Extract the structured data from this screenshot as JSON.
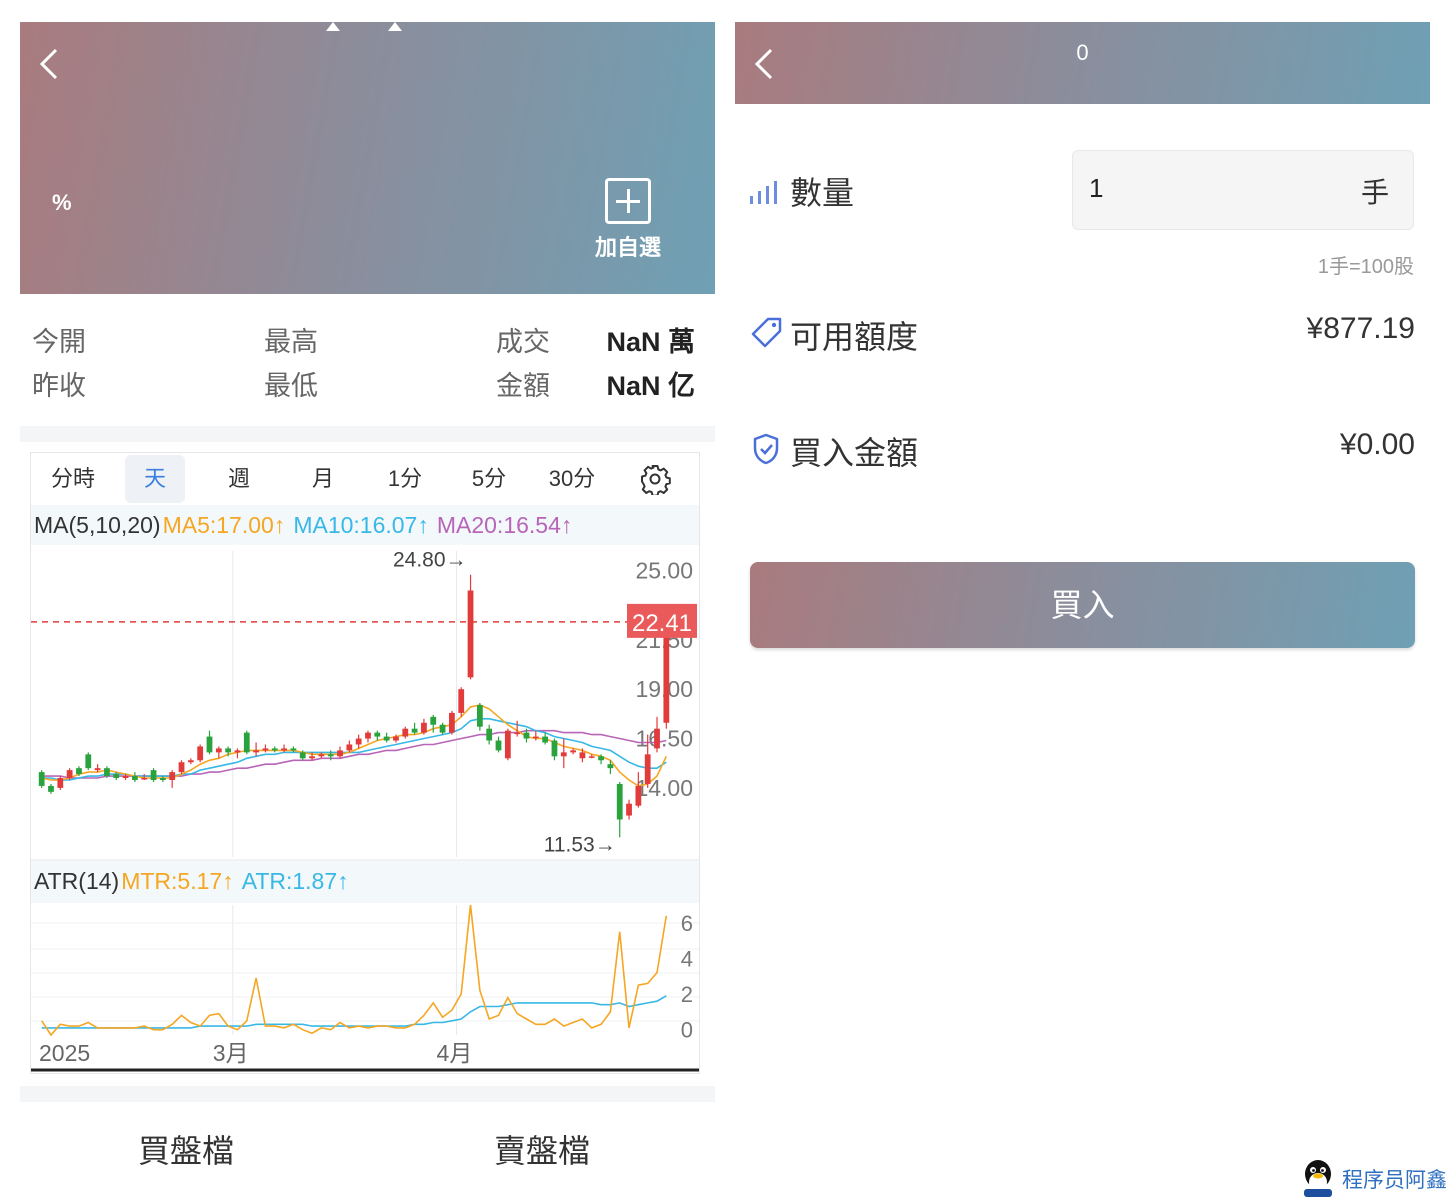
{
  "left_header": {
    "percent_label": "%",
    "add_favorite_label": "加自選"
  },
  "quote": {
    "open_label": "今開",
    "prev_close_label": "昨收",
    "high_label": "最高",
    "low_label": "最低",
    "volume_label": "成交",
    "amount_label": "金額",
    "volume_value": "NaN 萬",
    "amount_value": "NaN 亿"
  },
  "periods": [
    "分時",
    "天",
    "週",
    "月",
    "1分",
    "5分",
    "30分"
  ],
  "active_period": "天",
  "ma_indicator": {
    "name": "MA(5,10,20)",
    "ma5": "MA5:17.00↑",
    "ma10": "MA10:16.07↑",
    "ma20": "MA20:16.54↑"
  },
  "atr_indicator": {
    "name": "ATR(14)",
    "mtr": "MTR:5.17↑",
    "atr": "ATR:1.87↑"
  },
  "colors": {
    "up": "#e23b3b",
    "down": "#2aa33f",
    "ma5": "#f5a623",
    "ma10": "#38b8e6",
    "ma20": "#b865b8",
    "accent": "#3a7ee0"
  },
  "chart_data": [
    {
      "type": "candlestick",
      "title": "",
      "x_labels": [
        "2025",
        "3月",
        "4月"
      ],
      "y_ticks": [
        "25.00",
        "21.50",
        "19.00",
        "16.50",
        "14.00"
      ],
      "ylim": [
        10.5,
        26.0
      ],
      "last_price": "22.41",
      "max_label": "24.80→",
      "min_label": "11.53→",
      "candles": [
        [
          14.8,
          14.1,
          14.9,
          14.0
        ],
        [
          14.1,
          13.8,
          14.2,
          13.7
        ],
        [
          14.0,
          14.5,
          14.6,
          13.9
        ],
        [
          14.5,
          14.9,
          15.0,
          14.4
        ],
        [
          15.0,
          14.7,
          15.1,
          14.6
        ],
        [
          15.7,
          15.0,
          15.8,
          14.9
        ],
        [
          14.9,
          15.0,
          15.2,
          14.8
        ],
        [
          15.0,
          14.6,
          15.1,
          14.5
        ],
        [
          14.7,
          14.5,
          14.8,
          14.4
        ],
        [
          14.5,
          14.6,
          14.7,
          14.4
        ],
        [
          14.6,
          14.4,
          14.8,
          14.3
        ],
        [
          14.5,
          14.5,
          14.7,
          14.4
        ],
        [
          14.9,
          14.4,
          15.0,
          14.3
        ],
        [
          14.5,
          14.4,
          14.6,
          14.3
        ],
        [
          14.4,
          14.8,
          14.9,
          14.0
        ],
        [
          14.8,
          15.3,
          15.4,
          14.7
        ],
        [
          15.3,
          15.4,
          15.5,
          15.2
        ],
        [
          15.4,
          16.1,
          16.2,
          15.3
        ],
        [
          16.6,
          15.8,
          16.9,
          15.7
        ],
        [
          15.8,
          16.0,
          16.1,
          15.5
        ],
        [
          16.0,
          15.8,
          16.1,
          15.6
        ],
        [
          15.8,
          15.9,
          16.0,
          15.5
        ],
        [
          16.8,
          15.8,
          16.9,
          15.7
        ],
        [
          15.8,
          15.9,
          16.3,
          15.6
        ],
        [
          15.9,
          16.0,
          16.2,
          15.8
        ],
        [
          16.0,
          15.9,
          16.1,
          15.8
        ],
        [
          15.9,
          16.0,
          16.2,
          15.8
        ],
        [
          16.0,
          15.9,
          16.1,
          15.8
        ],
        [
          15.8,
          15.5,
          15.9,
          15.4
        ],
        [
          15.5,
          15.6,
          15.8,
          15.4
        ],
        [
          15.6,
          15.7,
          15.8,
          15.5
        ],
        [
          15.7,
          15.6,
          15.9,
          15.4
        ],
        [
          15.6,
          15.9,
          16.1,
          15.5
        ],
        [
          15.9,
          16.2,
          16.4,
          15.8
        ],
        [
          16.2,
          16.5,
          16.7,
          16.0
        ],
        [
          16.5,
          16.8,
          16.9,
          16.3
        ],
        [
          16.8,
          16.6,
          16.9,
          16.4
        ],
        [
          16.6,
          16.4,
          16.8,
          16.3
        ],
        [
          16.4,
          16.6,
          16.7,
          16.3
        ],
        [
          16.6,
          17.0,
          17.1,
          16.5
        ],
        [
          17.0,
          16.8,
          17.3,
          16.7
        ],
        [
          16.8,
          17.3,
          17.5,
          16.7
        ],
        [
          17.6,
          17.2,
          17.7,
          16.8
        ],
        [
          17.2,
          16.8,
          17.3,
          16.7
        ],
        [
          16.8,
          17.8,
          17.9,
          16.7
        ],
        [
          17.8,
          19.0,
          19.1,
          17.6
        ],
        [
          19.6,
          24.0,
          24.8,
          19.5
        ],
        [
          18.2,
          17.1,
          18.3,
          16.9
        ],
        [
          17.0,
          16.4,
          17.2,
          16.2
        ],
        [
          16.4,
          15.9,
          16.6,
          15.8
        ],
        [
          15.5,
          16.9,
          17.0,
          15.4
        ],
        [
          16.8,
          16.8,
          17.4,
          16.6
        ],
        [
          16.8,
          16.5,
          17.0,
          16.3
        ],
        [
          16.6,
          16.6,
          16.9,
          16.4
        ],
        [
          16.6,
          16.3,
          16.8,
          16.2
        ],
        [
          16.4,
          15.6,
          16.5,
          15.4
        ],
        [
          15.6,
          15.8,
          16.5,
          15.0
        ],
        [
          15.8,
          15.9,
          16.0,
          15.7
        ],
        [
          15.5,
          15.8,
          16.0,
          15.3
        ],
        [
          15.6,
          15.6,
          15.7,
          15.5
        ],
        [
          15.6,
          15.4,
          15.7,
          15.2
        ],
        [
          15.2,
          15.0,
          15.4,
          14.7
        ],
        [
          14.2,
          12.4,
          14.3,
          11.5
        ],
        [
          12.6,
          13.2,
          13.4,
          12.4
        ],
        [
          13.1,
          14.1,
          14.8,
          13.0
        ],
        [
          14.2,
          15.7,
          16.7,
          14.0
        ],
        [
          16.0,
          17.0,
          17.6,
          15.8
        ],
        [
          17.3,
          22.3,
          22.8,
          17.0
        ]
      ],
      "ma5": [
        14.5,
        14.4,
        14.4,
        14.5,
        14.7,
        14.8,
        14.8,
        14.9,
        14.8,
        14.7,
        14.6,
        14.5,
        14.5,
        14.5,
        14.5,
        14.7,
        14.9,
        15.2,
        15.4,
        15.5,
        15.7,
        15.8,
        15.9,
        15.9,
        15.9,
        15.9,
        15.9,
        15.9,
        15.8,
        15.7,
        15.7,
        15.7,
        15.7,
        15.8,
        16.0,
        16.2,
        16.4,
        16.5,
        16.6,
        16.7,
        16.7,
        16.8,
        17.0,
        17.1,
        17.2,
        17.6,
        18.1,
        18.2,
        18.0,
        17.6,
        17.2,
        16.9,
        16.6,
        16.5,
        16.5,
        16.3,
        16.1,
        16.0,
        15.9,
        15.7,
        15.6,
        15.4,
        14.8,
        14.4,
        14.1,
        14.2,
        14.6,
        15.6
      ],
      "ma10": [
        14.5,
        14.5,
        14.4,
        14.4,
        14.5,
        14.6,
        14.6,
        14.7,
        14.7,
        14.7,
        14.6,
        14.6,
        14.6,
        14.6,
        14.6,
        14.7,
        14.7,
        14.9,
        15.0,
        15.1,
        15.2,
        15.3,
        15.5,
        15.6,
        15.7,
        15.7,
        15.8,
        15.8,
        15.8,
        15.8,
        15.8,
        15.8,
        15.8,
        15.8,
        15.8,
        15.9,
        16.0,
        16.1,
        16.2,
        16.3,
        16.4,
        16.5,
        16.6,
        16.7,
        16.8,
        17.0,
        17.4,
        17.5,
        17.5,
        17.4,
        17.3,
        17.2,
        17.1,
        16.9,
        16.8,
        16.6,
        16.5,
        16.4,
        16.3,
        16.1,
        16.0,
        15.9,
        15.6,
        15.3,
        15.1,
        15.0,
        15.0,
        15.3
      ],
      "ma20": [
        14.6,
        14.6,
        14.6,
        14.5,
        14.5,
        14.5,
        14.5,
        14.6,
        14.6,
        14.6,
        14.6,
        14.6,
        14.6,
        14.6,
        14.6,
        14.6,
        14.7,
        14.7,
        14.8,
        14.8,
        14.9,
        15.0,
        15.0,
        15.1,
        15.2,
        15.2,
        15.3,
        15.4,
        15.4,
        15.4,
        15.5,
        15.5,
        15.5,
        15.6,
        15.7,
        15.7,
        15.8,
        15.9,
        15.9,
        16.0,
        16.1,
        16.2,
        16.2,
        16.3,
        16.4,
        16.5,
        16.6,
        16.7,
        16.7,
        16.8,
        16.8,
        16.8,
        16.9,
        16.9,
        16.9,
        16.9,
        16.8,
        16.8,
        16.8,
        16.7,
        16.7,
        16.6,
        16.5,
        16.4,
        16.3,
        16.3,
        16.3,
        16.4
      ]
    },
    {
      "type": "line",
      "title": "",
      "y_ticks": [
        "6",
        "4",
        "2",
        "0"
      ],
      "ylim": [
        -0.3,
        7.0
      ],
      "series": [
        {
          "name": "MTR",
          "values": [
            0.5,
            -0.3,
            0.3,
            0.2,
            0.2,
            0.4,
            0.1,
            0.1,
            0.1,
            0.1,
            0.1,
            0.2,
            0.0,
            0.0,
            0.3,
            0.8,
            0.4,
            0.2,
            0.8,
            0.9,
            0.2,
            0.0,
            0.5,
            2.9,
            0.2,
            0.2,
            0.1,
            0.3,
            0.0,
            -0.2,
            0.1,
            0.0,
            0.4,
            0.1,
            0.2,
            0.1,
            0.2,
            0.2,
            0.1,
            0.1,
            0.3,
            0.8,
            1.5,
            0.7,
            1.1,
            2.0,
            7.0,
            2.2,
            0.6,
            0.8,
            1.8,
            0.9,
            0.6,
            0.3,
            0.3,
            0.6,
            0.2,
            0.4,
            0.6,
            0.1,
            0.3,
            1.0,
            5.5,
            0.1,
            2.5,
            2.6,
            3.2,
            6.4
          ]
        },
        {
          "name": "ATR",
          "values": [
            0.1,
            0.1,
            0.1,
            0.1,
            0.1,
            0.1,
            0.1,
            0.1,
            0.1,
            0.1,
            0.1,
            0.1,
            0.1,
            0.1,
            0.1,
            0.1,
            0.1,
            0.2,
            0.2,
            0.2,
            0.2,
            0.2,
            0.2,
            0.3,
            0.3,
            0.3,
            0.3,
            0.3,
            0.3,
            0.2,
            0.2,
            0.2,
            0.2,
            0.2,
            0.2,
            0.2,
            0.2,
            0.2,
            0.2,
            0.2,
            0.3,
            0.3,
            0.4,
            0.4,
            0.5,
            0.6,
            1.0,
            1.3,
            1.3,
            1.3,
            1.4,
            1.5,
            1.5,
            1.5,
            1.5,
            1.5,
            1.5,
            1.5,
            1.5,
            1.5,
            1.4,
            1.4,
            1.5,
            1.3,
            1.4,
            1.5,
            1.6,
            1.9
          ]
        }
      ]
    }
  ],
  "order_book_tabs": {
    "bid": "買盤檔",
    "ask": "賣盤檔"
  },
  "right_header": {
    "title": "0"
  },
  "order_form": {
    "quantity_label": "數量",
    "quantity_value": "1",
    "quantity_unit": "手",
    "lot_hint": "1手=100股",
    "available_label": "可用額度",
    "available_value": "¥877.19",
    "buy_amount_label": "買入金額",
    "buy_amount_value": "¥0.00",
    "buy_button": "買入"
  },
  "watermark": "程序员阿鑫"
}
